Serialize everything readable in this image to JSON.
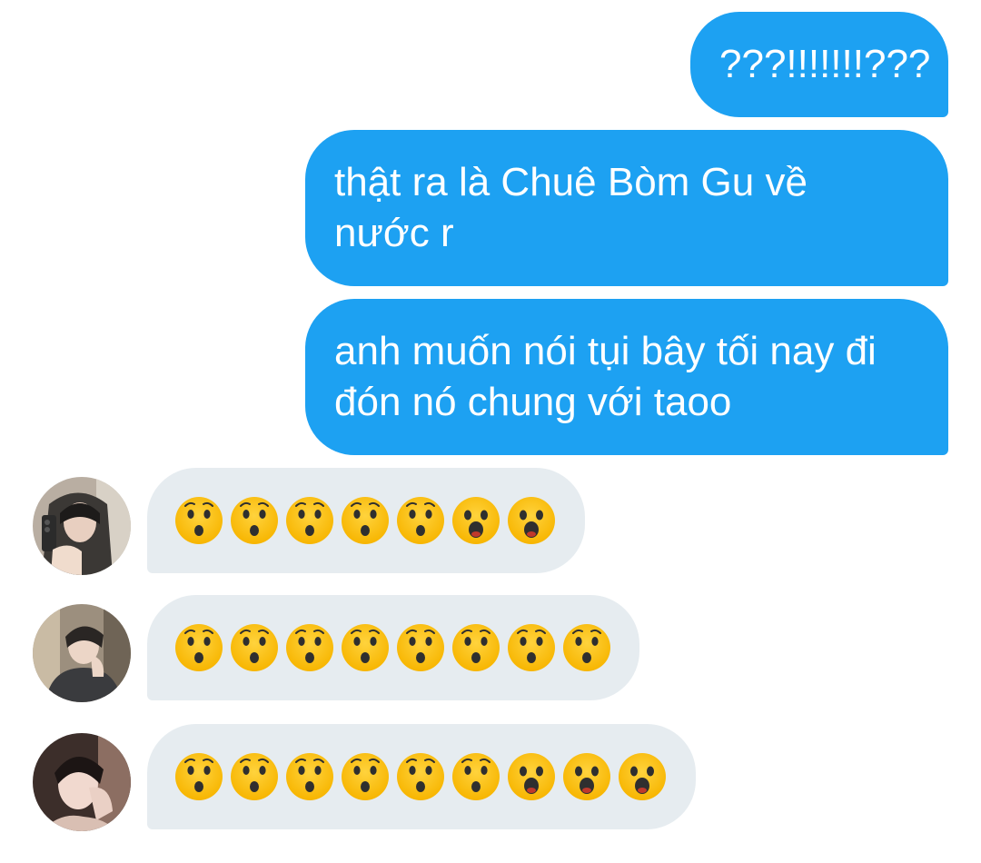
{
  "outgoing": [
    {
      "text": "???!!!!!!!???"
    },
    {
      "text": "thật ra là Chuê Bòm Gu về nước r"
    },
    {
      "text": "anh muốn nói tụi bây tối nay đi đón nó chung với taoo"
    }
  ],
  "incoming": [
    {
      "emojis": [
        "hushed",
        "hushed",
        "hushed",
        "hushed",
        "hushed",
        "open-mouth",
        "open-mouth"
      ]
    },
    {
      "emojis": [
        "hushed",
        "hushed",
        "hushed",
        "hushed",
        "hushed",
        "hushed",
        "hushed",
        "hushed"
      ]
    },
    {
      "emojis": [
        "hushed",
        "hushed",
        "hushed",
        "hushed",
        "hushed",
        "hushed",
        "open-mouth",
        "open-mouth",
        "open-mouth"
      ]
    }
  ],
  "colors": {
    "outgoing_bubble": "#1da1f2",
    "incoming_bubble": "#e6ecf0",
    "emoji_face": "#fcc21b",
    "emoji_feature": "#2f2f2f"
  }
}
